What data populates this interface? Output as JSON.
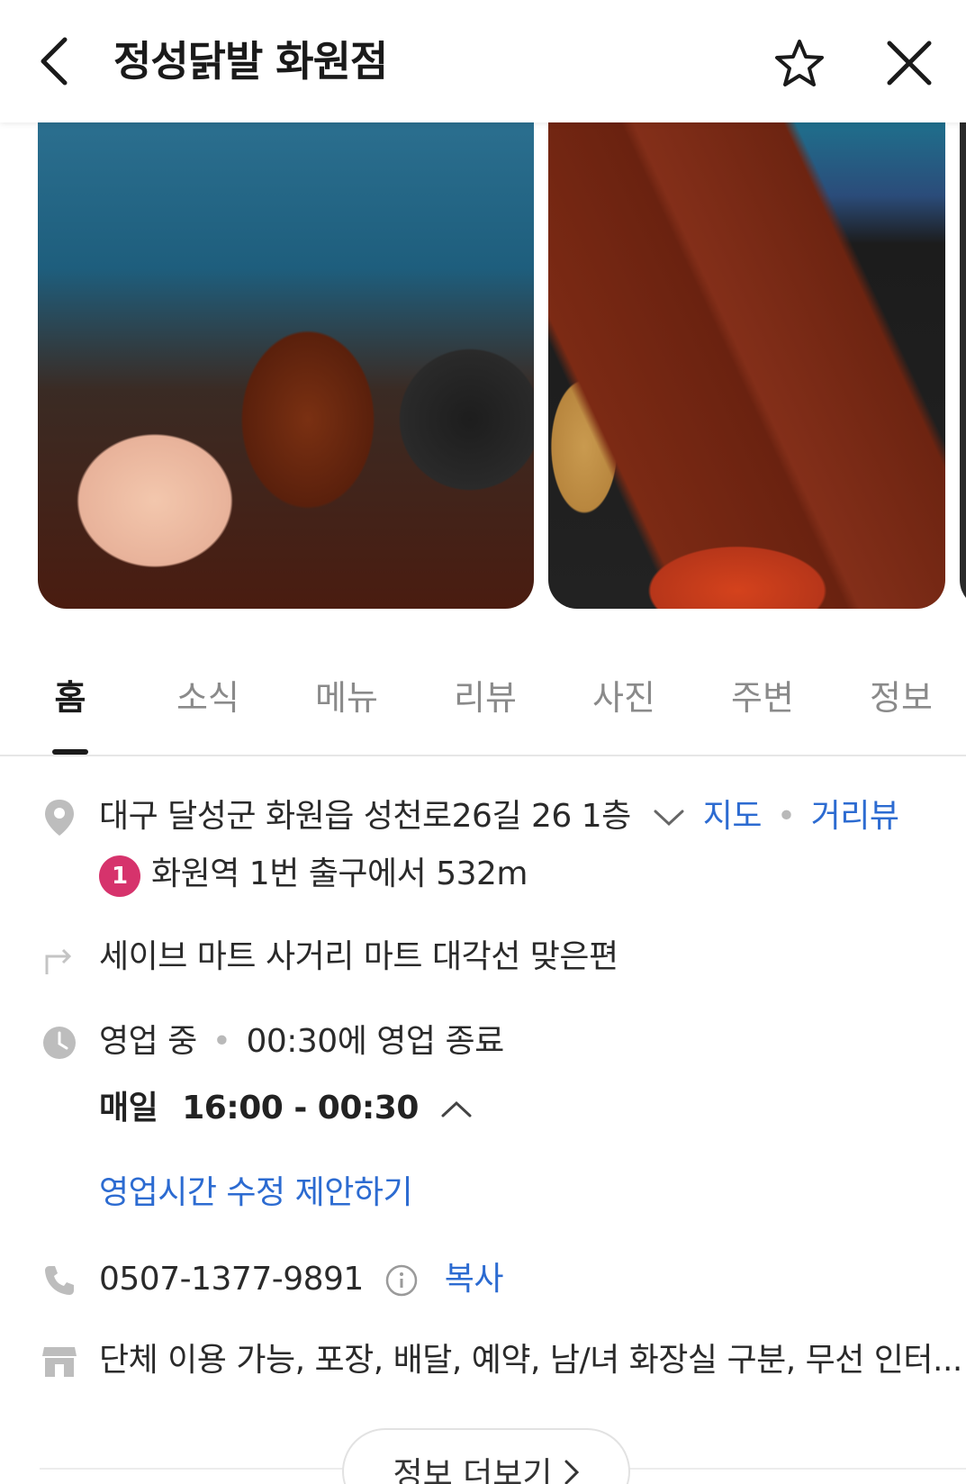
{
  "header": {
    "title": "정성닭발 화원점",
    "back_icon": "chevron-left-icon",
    "star_icon": "star-outline-icon",
    "close_icon": "close-icon"
  },
  "tabs": [
    {
      "label": "홈",
      "active": true
    },
    {
      "label": "소식",
      "active": false
    },
    {
      "label": "메뉴",
      "active": false
    },
    {
      "label": "리뷰",
      "active": false
    },
    {
      "label": "사진",
      "active": false
    },
    {
      "label": "주변",
      "active": false
    },
    {
      "label": "정보",
      "active": false
    }
  ],
  "address": {
    "text": "대구 달성군 화원읍 성천로26길 26 1층",
    "map_link": "지도",
    "separator": "•",
    "street_view_link": "거리뷰"
  },
  "subway": {
    "line": "1",
    "text": "화원역 1번 출구에서 532m"
  },
  "directions": {
    "text": "세이브 마트 사거리 마트 대각선 맞은편"
  },
  "hours": {
    "status": "영업 중",
    "separator": "•",
    "closing": "00:30에 영업 종료",
    "day_label": "매일",
    "time_range": "16:00 - 00:30",
    "suggest_link": "영업시간 수정 제안하기"
  },
  "phone": {
    "number": "0507-1377-9891",
    "copy_link": "복사"
  },
  "amenities": {
    "text": "단체 이용 가능, 포장, 배달, 예약, 남/녀 화장실 구분, 무선 인터..."
  },
  "more_button": {
    "label": "정보 더보기"
  },
  "colors": {
    "link": "#2c6bd1",
    "subway_line_1": "#d6336c",
    "tab_active": "#1a1a1a",
    "tab_inactive": "#8a8a8a"
  }
}
